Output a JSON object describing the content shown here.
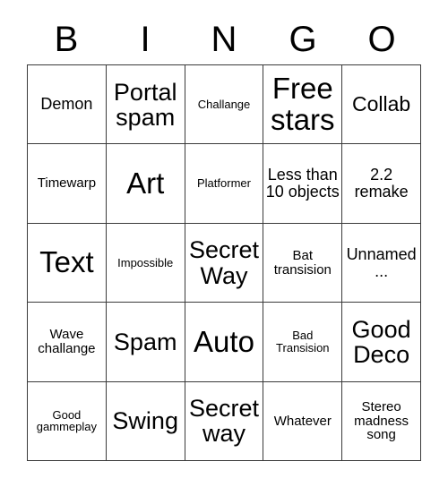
{
  "card": {
    "header_letters": [
      "B",
      "I",
      "N",
      "G",
      "O"
    ],
    "columns": 5,
    "rows": 5,
    "border_color": "#3a3a3a",
    "background_color": "#ffffff",
    "text_color": "#000000",
    "cells": [
      [
        {
          "label": "Demon",
          "size": "md"
        },
        {
          "label": "Portal spam",
          "size": "xl"
        },
        {
          "label": "Challange",
          "size": "xs"
        },
        {
          "label": "Free stars",
          "size": "xxl"
        },
        {
          "label": "Collab",
          "size": "lg"
        }
      ],
      [
        {
          "label": "Timewarp",
          "size": "sm"
        },
        {
          "label": "Art",
          "size": "xxl"
        },
        {
          "label": "Platformer",
          "size": "xs"
        },
        {
          "label": "Less than 10 objects",
          "size": "md"
        },
        {
          "label": "2.2 remake",
          "size": "md"
        }
      ],
      [
        {
          "label": "Text",
          "size": "xxl"
        },
        {
          "label": "Impossible",
          "size": "xs"
        },
        {
          "label": "Secret Way",
          "size": "xl"
        },
        {
          "label": "Bat transision",
          "size": "sm"
        },
        {
          "label": "Unnamed ...",
          "size": "md"
        }
      ],
      [
        {
          "label": "Wave challange",
          "size": "sm"
        },
        {
          "label": "Spam",
          "size": "xl"
        },
        {
          "label": "Auto",
          "size": "xxl"
        },
        {
          "label": "Bad Transision",
          "size": "xs"
        },
        {
          "label": "Good Deco",
          "size": "xl"
        }
      ],
      [
        {
          "label": "Good gammeplay",
          "size": "xs"
        },
        {
          "label": "Swing",
          "size": "xl"
        },
        {
          "label": "Secret way",
          "size": "xl"
        },
        {
          "label": "Whatever",
          "size": "sm"
        },
        {
          "label": "Stereo madness song",
          "size": "sm"
        }
      ]
    ]
  }
}
